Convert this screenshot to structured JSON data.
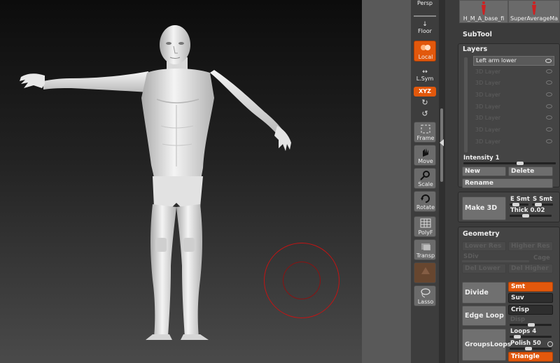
{
  "colors": {
    "accent": "#e2580c",
    "brush_ring": "#c21414",
    "panel_bg": "#3b3b3b"
  },
  "shelf": {
    "persp_label": "Persp",
    "floor_label": "Floor",
    "local_label": "Local",
    "lsym_label": "L.Sym",
    "xyz_label": "XYZ",
    "frame_label": "Frame",
    "move_label": "Move",
    "scale_label": "Scale",
    "rotate_label": "Rotate",
    "polyf_label": "PolyF",
    "transp_label": "Transp",
    "lasso_label": "Lasso"
  },
  "tools": [
    {
      "caption": "H_M_A_base_fi"
    },
    {
      "caption": "SuperAverageMa"
    }
  ],
  "subtool": {
    "title": "SubTool"
  },
  "layers": {
    "title": "Layers",
    "items": [
      {
        "name": "Left arm lower"
      },
      {
        "name": "3D Layer"
      },
      {
        "name": "3D Layer"
      },
      {
        "name": "3D Layer"
      },
      {
        "name": "3D Layer"
      },
      {
        "name": "3D Layer"
      },
      {
        "name": "3D Layer"
      },
      {
        "name": "3D Layer"
      }
    ],
    "intensity_label": "Intensity",
    "intensity_value": "1",
    "new_label": "New",
    "delete_label": "Delete",
    "rename_label": "Rename",
    "make3d_label": "Make 3D",
    "esmt_label": "E Smt",
    "ssmt_label": "S Smt",
    "thick_label": "Thick",
    "thick_value": "0.02"
  },
  "geometry": {
    "title": "Geometry",
    "lower_res": "Lower Res",
    "higher_res": "Higher Res",
    "sdiv_label": "SDiv",
    "cage_label": "Cage",
    "del_lower": "Del Lower",
    "del_higher": "Del Higher",
    "divide_label": "Divide",
    "smt_label": "Smt",
    "suv_label": "Suv",
    "edge_loop_label": "Edge Loop",
    "crisp_label": "Crisp",
    "disp_label": "Disp",
    "groups_loops_label": "GroupsLoops",
    "loops_label": "Loops",
    "loops_value": "4",
    "polish_label": "Polish",
    "polish_value": "50",
    "triangle_label": "Triangle"
  }
}
